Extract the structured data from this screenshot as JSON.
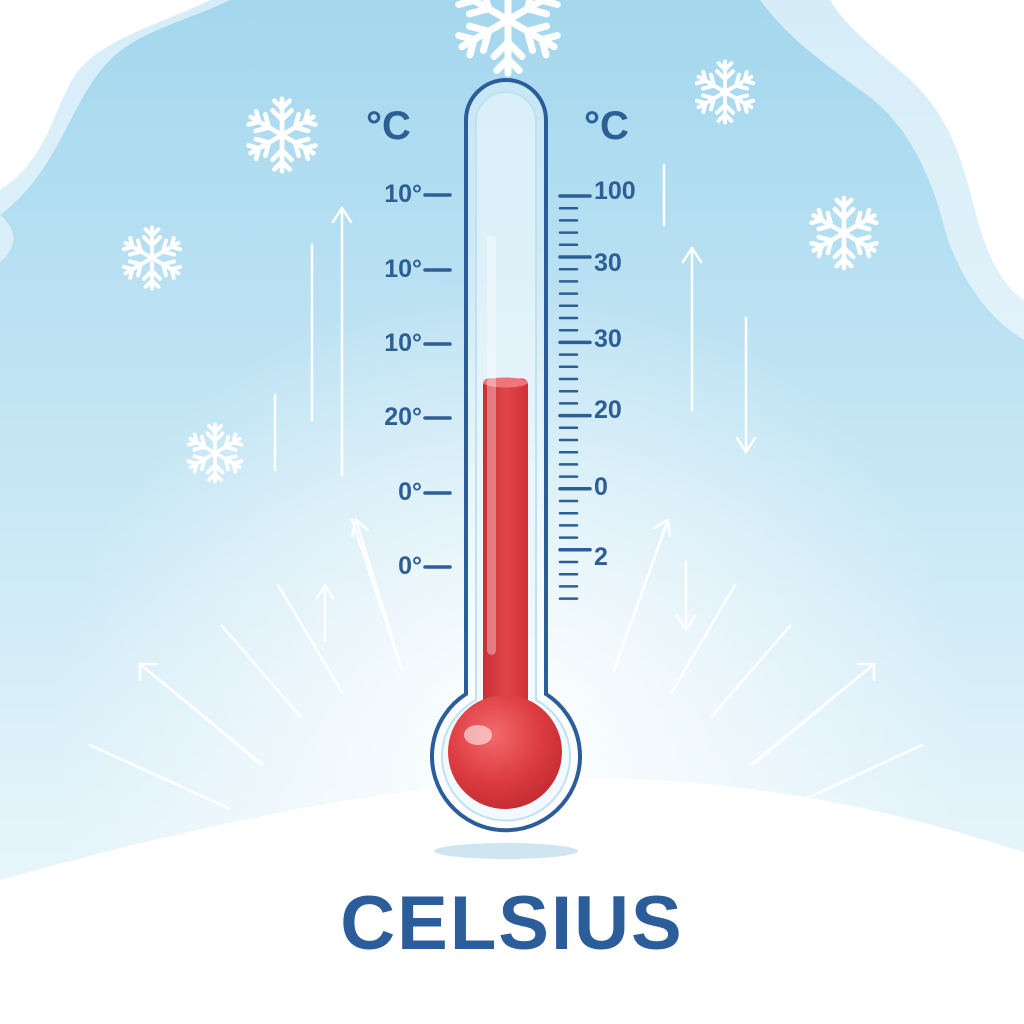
{
  "title": "CELSIUS",
  "thermometer": {
    "left_unit": "°C",
    "right_unit": "°C",
    "left_scale": [
      "10°",
      "10°",
      "10°",
      "20°",
      "0°",
      "0°"
    ],
    "right_scale": [
      "100",
      "30",
      "30",
      "20",
      "0",
      "2"
    ],
    "mercury_level_fraction": 0.56
  },
  "icons": [
    "snowflake-icon",
    "arrow-up-icon",
    "arrow-down-icon"
  ],
  "colors": {
    "sky_top": "#a6d8ee",
    "sky_bottom": "#eef8fc",
    "snow": "#ffffff",
    "mercury": "#dc3b40",
    "text": "#2d5f94",
    "outline": "#2a5d99"
  }
}
